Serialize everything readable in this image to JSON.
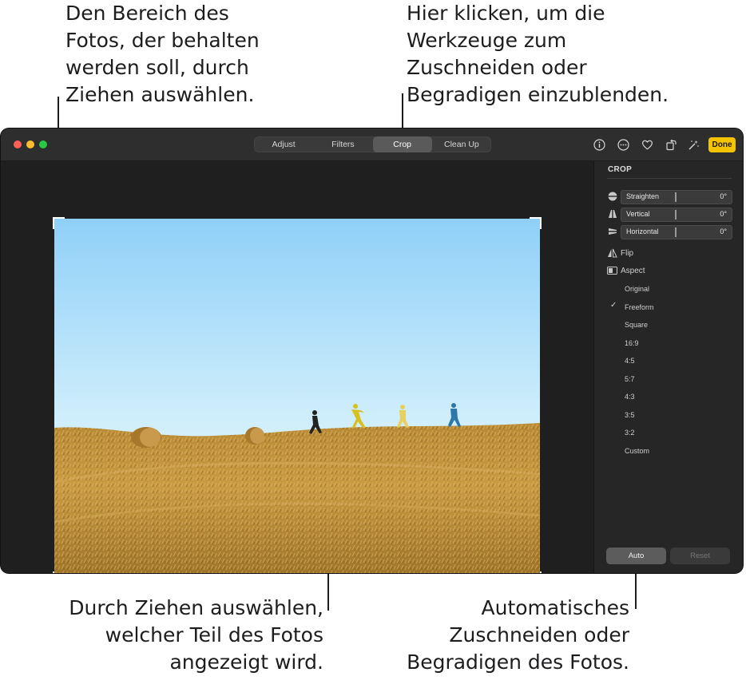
{
  "callouts": {
    "top_left": [
      "Den Bereich des",
      "Fotos, der behalten",
      "werden soll, durch",
      "Ziehen auswählen."
    ],
    "top_right": [
      "Hier klicken, um die",
      "Werkzeuge zum",
      "Zuschneiden oder",
      "Begradigen einzublenden."
    ],
    "bottom_left": [
      "Durch Ziehen auswählen,",
      "welcher Teil des Fotos",
      "angezeigt wird."
    ],
    "bottom_right": [
      "Automatisches",
      "Zuschneiden oder",
      "Begradigen des Fotos."
    ]
  },
  "toolbar": {
    "tabs": [
      "Adjust",
      "Filters",
      "Crop",
      "Clean Up"
    ],
    "active_tab": "Crop",
    "icons": [
      "info-icon",
      "more-icon",
      "favorite-icon",
      "rotate-icon",
      "magic-wand-icon"
    ],
    "done_label": "Done",
    "done_color": "#f5c400"
  },
  "sidebar": {
    "title": "CROP",
    "sliders": [
      {
        "label": "Straighten",
        "value": "0°",
        "icon": "straighten-icon"
      },
      {
        "label": "Vertical",
        "value": "0°",
        "icon": "vertical-icon"
      },
      {
        "label": "Horizontal",
        "value": "0°",
        "icon": "horizontal-icon"
      }
    ],
    "flip_label": "Flip",
    "aspect_label": "Aspect",
    "aspect_options": [
      "Original",
      "Freeform",
      "Square",
      "16:9",
      "4:5",
      "5:7",
      "4:3",
      "3:5",
      "3:2",
      "Custom"
    ],
    "aspect_selected": "Freeform",
    "auto_label": "Auto",
    "reset_label": "Reset"
  }
}
